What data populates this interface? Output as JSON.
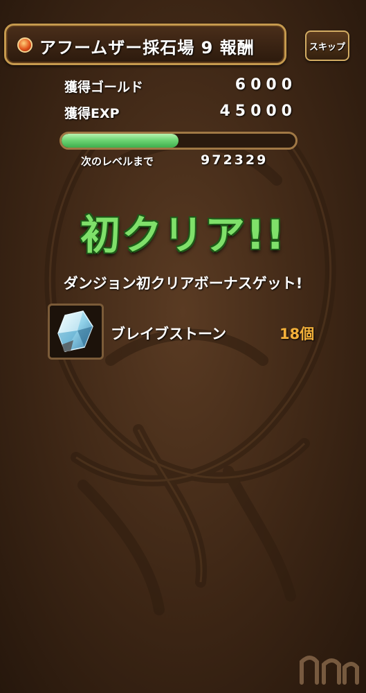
{
  "header": {
    "title": "アフームザー採石場 9 報酬",
    "skip_label": "スキップ"
  },
  "rewards": {
    "gold_label": "獲得ゴールド",
    "gold_value": "6000",
    "exp_label": "獲得EXP",
    "exp_value": "45000"
  },
  "level": {
    "progress_fraction": 0.5,
    "next_label": "次のレベルまで",
    "next_value": "972329"
  },
  "first_clear": {
    "title": "初クリア!!",
    "bonus_text": "ダンジョン初クリアボーナスゲット!",
    "item_name": "ブレイブストーン",
    "item_count": "18個",
    "item_icon": "brave-stone-crystal-icon"
  },
  "colors": {
    "accent_green": "#7fe06a",
    "count_orange": "#f3b03a",
    "frame_gold": "#c69a4e"
  }
}
